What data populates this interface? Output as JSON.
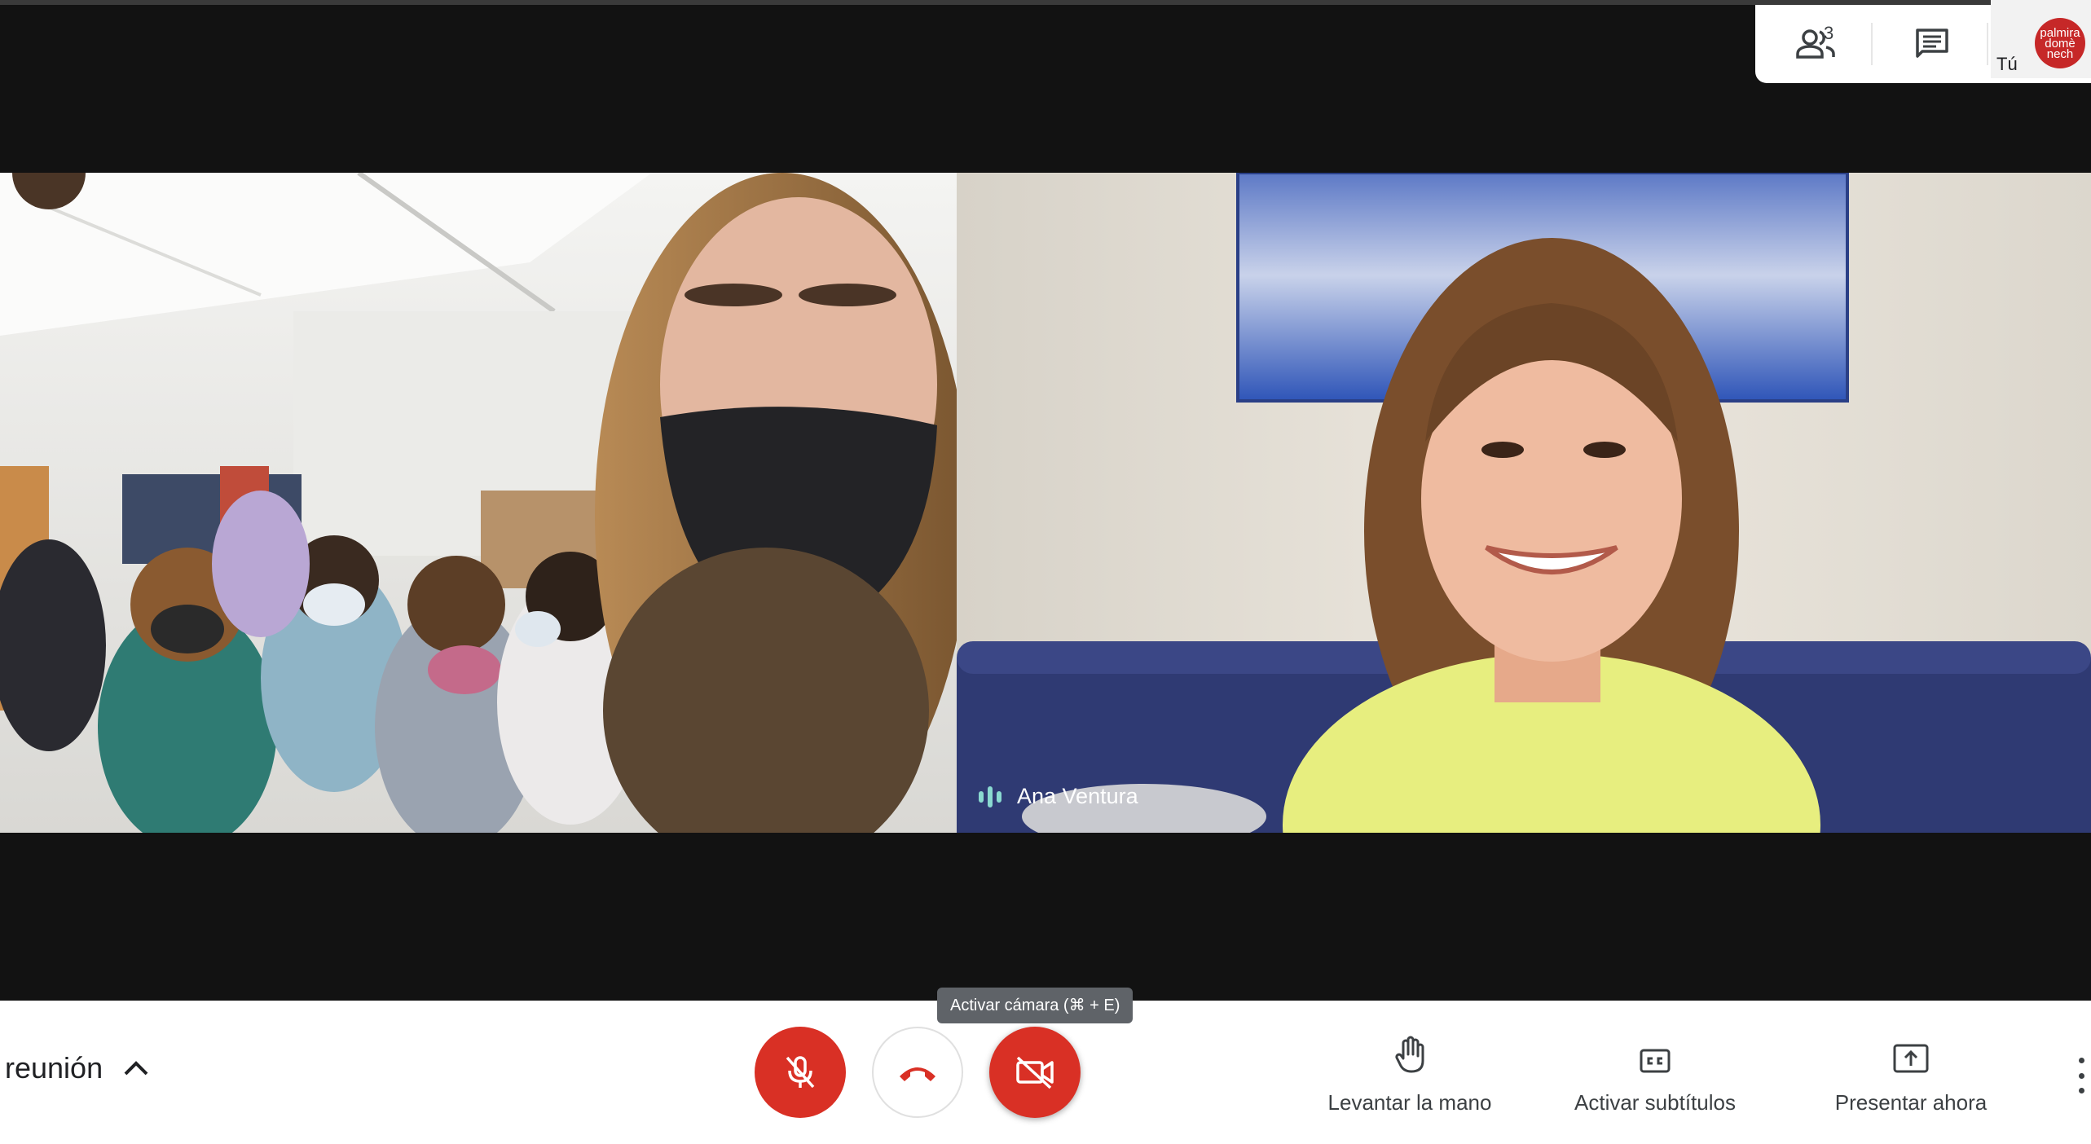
{
  "top_panel": {
    "participant_count": "3",
    "you_label": "Tú",
    "avatar_text": [
      "palmira",
      "domè",
      "nech"
    ]
  },
  "tiles": {
    "right_participant_name": "Ana Ventura"
  },
  "bottom_bar": {
    "meeting_label": "reunión",
    "camera_tooltip": "Activar cámara (⌘ + E)",
    "raise_hand_label": "Levantar la mano",
    "captions_label": "Activar subtítulos",
    "present_label": "Presentar ahora"
  },
  "colors": {
    "accent_red": "#d93025",
    "speaking_indicator": "#8ad9d0",
    "background": "#121212"
  },
  "icons": [
    "people-icon",
    "chat-icon",
    "mic-off-icon",
    "call-end-icon",
    "videocam-off-icon",
    "hand-icon",
    "closed-caption-icon",
    "present-icon",
    "more-vert-icon",
    "chevron-up-icon",
    "speaking-icon"
  ]
}
